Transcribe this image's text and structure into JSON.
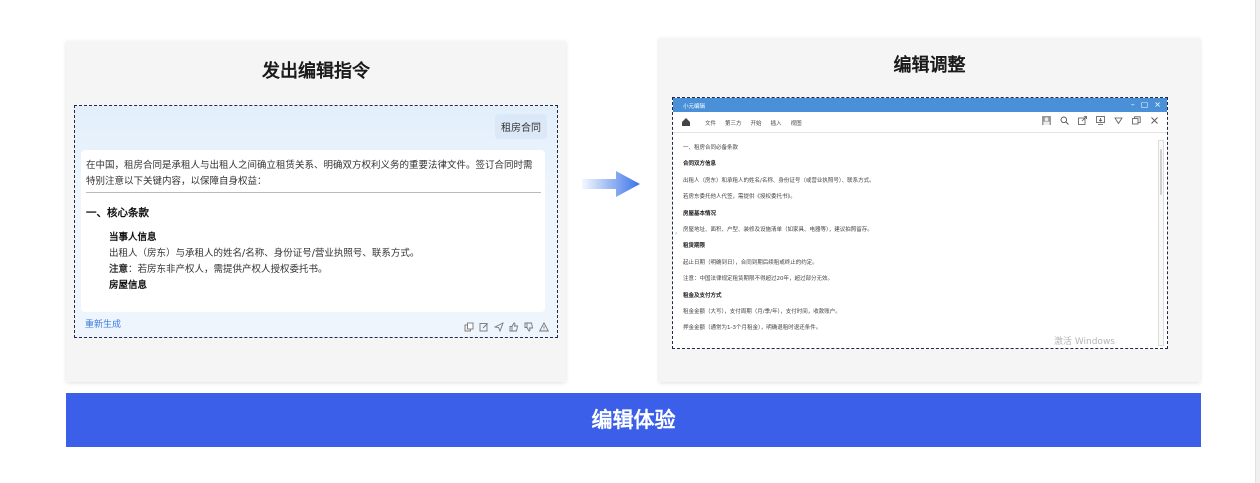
{
  "left_panel": {
    "title": "发出编辑指令",
    "user_message": "租房合同",
    "answer": {
      "intro": "在中国，租房合同是承租人与出租人之间确立租赁关系、明确双方权利义务的重要法律文件。签订合同时需特别注意以下关键内容，以保障自身权益：",
      "section_heading": "一、核心条款",
      "item1_title": "当事人信息",
      "item1_text": "出租人（房东）与承租人的姓名/名称、身份证号/营业执照号、联系方式。",
      "note_label": "注意",
      "note_text": "：若房东非产权人，需提供产权人授权委托书。",
      "item2_title": "房屋信息"
    },
    "regenerate_label": "重新生成",
    "action_icons": [
      "copy-icon",
      "edit-icon",
      "share-icon",
      "thumbs-up-icon",
      "thumbs-down-icon",
      "warning-icon"
    ]
  },
  "right_panel": {
    "title": "编辑调整",
    "editor": {
      "window_title": "小元编辑",
      "menu": [
        "文件",
        "第三方",
        "开始",
        "插入",
        "视图"
      ],
      "lines": [
        {
          "text": "一、租房合同必备条款",
          "bold": false
        },
        {
          "text": "合同双方信息",
          "bold": true
        },
        {
          "text": "出租人（房东）和承租人的姓名/名称、身份证号（或营业执照号）、联系方式。",
          "bold": false
        },
        {
          "text": "若房东委托他人代签，需提供《授权委托书》。",
          "bold": false
        },
        {
          "text": "房屋基本情况",
          "bold": true
        },
        {
          "text": "房屋地址、面积、户型、装修及设施清单（如家具、电器等），建议拍照留存。",
          "bold": false
        },
        {
          "text": "租赁期限",
          "bold": true
        },
        {
          "text": "起止日期（明确到日），合同到期后续租或终止的约定。",
          "bold": false
        },
        {
          "text": "注意：中国法律规定租赁期限不得超过20年，超过部分无效。",
          "bold": false
        },
        {
          "text": "租金及支付方式",
          "bold": true
        },
        {
          "text": "租金金额（大写），支付周期（月/季/年），支付时间，收款账户。",
          "bold": false
        },
        {
          "text": "押金金额（通常为1-3个月租金），明确退租时退还条件。",
          "bold": false
        }
      ],
      "watermark": "激活 Windows"
    }
  },
  "banner": {
    "label": "编辑体验"
  },
  "colors": {
    "banner": "#3c5fea",
    "editor_titlebar": "#4a90d9",
    "arrow": "#3b73e8"
  }
}
